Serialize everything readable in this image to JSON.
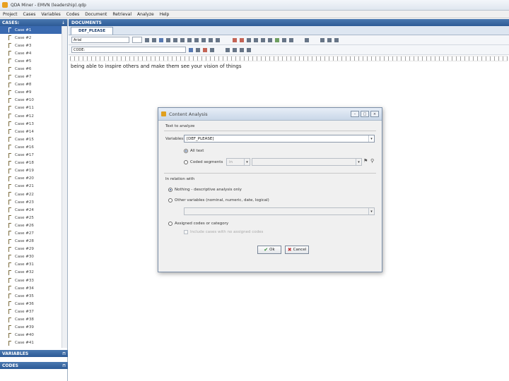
{
  "window": {
    "title": "QDA Miner - EMVN (leadership).qdp"
  },
  "menu": [
    "Project",
    "Cases",
    "Variables",
    "Codes",
    "Document",
    "Retrieval",
    "Analyze",
    "Help"
  ],
  "cases_panel": {
    "header": "CASES:",
    "items": [
      "Case #1",
      "Case #2",
      "Case #3",
      "Case #4",
      "Case #5",
      "Case #6",
      "Case #7",
      "Case #8",
      "Case #9",
      "Case #10",
      "Case #11",
      "Case #12",
      "Case #13",
      "Case #14",
      "Case #15",
      "Case #16",
      "Case #17",
      "Case #18",
      "Case #19",
      "Case #20",
      "Case #21",
      "Case #22",
      "Case #23",
      "Case #24",
      "Case #25",
      "Case #26",
      "Case #27",
      "Case #28",
      "Case #29",
      "Case #30",
      "Case #31",
      "Case #32",
      "Case #33",
      "Case #34",
      "Case #35",
      "Case #36",
      "Case #37",
      "Case #38",
      "Case #39",
      "Case #40",
      "Case #41"
    ],
    "selected_index": 0
  },
  "variables_panel": {
    "header": "VARIABLES"
  },
  "codes_panel": {
    "header": "CODES"
  },
  "documents": {
    "header": "DOCUMENTS",
    "tab": "DEF_PLEASE",
    "font_box": "Arial",
    "code_label": "CODE:",
    "text": "being able to inspire others and make them see your vision of things"
  },
  "dialog": {
    "title": "Content Analysis",
    "section_text": "Text to analyze",
    "variables_label": "Variables:",
    "variables_value": "[DEF_PLEASE]",
    "all_text": "All text",
    "coded_segments": "Coded segments",
    "coded_op": "in",
    "section_relation": "In relation with",
    "opt_nothing": "Nothing - descriptive analysis only",
    "opt_other_vars": "Other variables (nominal, numeric, date, logical)",
    "opt_assigned": "Assigned codes or category",
    "include_cases": "Include cases with no assigned codes",
    "ok": "Ok",
    "cancel": "Cancel"
  }
}
